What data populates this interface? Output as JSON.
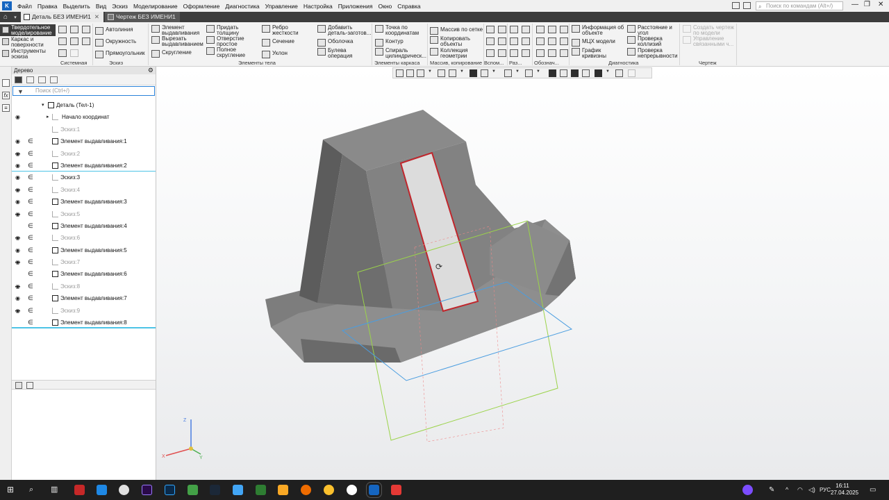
{
  "menu": {
    "items": [
      "Файл",
      "Правка",
      "Выделить",
      "Вид",
      "Эскиз",
      "Моделирование",
      "Оформление",
      "Диагностика",
      "Управление",
      "Настройка",
      "Приложения",
      "Окно",
      "Справка"
    ],
    "search_placeholder": "Поиск по командам (Alt+/)"
  },
  "tabs": [
    {
      "label": "Деталь БЕЗ ИМЕНИ1",
      "active": true
    },
    {
      "label": "Чертеж БЕЗ ИМЕНИ1",
      "active": false
    }
  ],
  "ribbon": {
    "modes": [
      "Твердотельное моделирование",
      "Каркас и поверхности",
      "Инструменты эскиза"
    ],
    "sketch": [
      "Автолиния",
      "Окружность",
      "Прямоугольник"
    ],
    "elements": [
      "Элемент выдавливания",
      "Вырезать выдавливанием",
      "Скругление",
      "Придать толщину",
      "Отверстие простое",
      "Полное скругление",
      "Ребро жесткости",
      "Сечение",
      "Уклон",
      "Добавить деталь-заготов...",
      "Оболочка",
      "Булева операция"
    ],
    "frame": [
      "Точка по координатам",
      "Контур",
      "Спираль цилиндрическ..."
    ],
    "array": [
      "Массив по сетке",
      "Копировать объекты",
      "Коллекция геометрии"
    ],
    "diag": [
      "Информация об объекте",
      "МЦХ модели",
      "График кривизны",
      "Расстояние и угол",
      "Проверка коллизий",
      "Проверка непрерывности"
    ],
    "drawing": [
      "Создать чертеж по модели",
      "Управление связанными ч..."
    ],
    "groups": [
      "Системная",
      "Эскиз",
      "Элементы тела",
      "Элементы каркаса",
      "Массив, копирование",
      "Вспом...",
      "Раз...",
      "Обознач...",
      "Диагностика",
      "Чертеж"
    ]
  },
  "tree": {
    "title": "Дерево",
    "search_placeholder": "Поиск (Ctrl+/)",
    "rows": [
      {
        "label": "Деталь (Тел-1)",
        "kind": "part",
        "eye": "none",
        "incl": false
      },
      {
        "label": "Начало координат",
        "kind": "origin",
        "eye": "on",
        "incl": false
      },
      {
        "label": "Эскиз:1",
        "kind": "sketch",
        "eye": "none",
        "incl": false
      },
      {
        "label": "Элемент выдавливания:1",
        "kind": "extrude",
        "eye": "on",
        "incl": true
      },
      {
        "label": "Эскиз:2",
        "kind": "sketch",
        "eye": "off",
        "incl": true
      },
      {
        "label": "Элемент выдавливания:2",
        "kind": "extrude",
        "eye": "on",
        "incl": true
      },
      {
        "label": "Эскиз:3",
        "kind": "sketch-active",
        "eye": "on",
        "incl": true
      },
      {
        "label": "Эскиз:4",
        "kind": "sketch",
        "eye": "off",
        "incl": true
      },
      {
        "label": "Элемент выдавливания:3",
        "kind": "extrude",
        "eye": "on",
        "incl": true
      },
      {
        "label": "Эскиз:5",
        "kind": "sketch",
        "eye": "off",
        "incl": true
      },
      {
        "label": "Элемент выдавливания:4",
        "kind": "extrude2",
        "eye": "none",
        "incl": true
      },
      {
        "label": "Эскиз:6",
        "kind": "sketch",
        "eye": "off",
        "incl": true
      },
      {
        "label": "Элемент выдавливания:5",
        "kind": "extrude",
        "eye": "on",
        "incl": true
      },
      {
        "label": "Эскиз:7",
        "kind": "sketch",
        "eye": "off",
        "incl": true
      },
      {
        "label": "Элемент выдавливания:6",
        "kind": "extrude2",
        "eye": "none",
        "incl": true
      },
      {
        "label": "Эскиз:8",
        "kind": "sketch",
        "eye": "off",
        "incl": true
      },
      {
        "label": "Элемент выдавливания:7",
        "kind": "extrude",
        "eye": "on",
        "incl": true
      },
      {
        "label": "Эскиз:9",
        "kind": "sketch",
        "eye": "off",
        "incl": true
      },
      {
        "label": "Элемент выдавливания:8",
        "kind": "extrude2",
        "eye": "none",
        "incl": true
      }
    ]
  },
  "viewport": {
    "axes": {
      "x": "X",
      "y": "Y",
      "z": "Z"
    },
    "selection_color": "#c0262c",
    "model_color": "#7a7a7a"
  },
  "taskbar": {
    "lang": "РУС",
    "time": "16:11",
    "date": "27.04.2025"
  }
}
